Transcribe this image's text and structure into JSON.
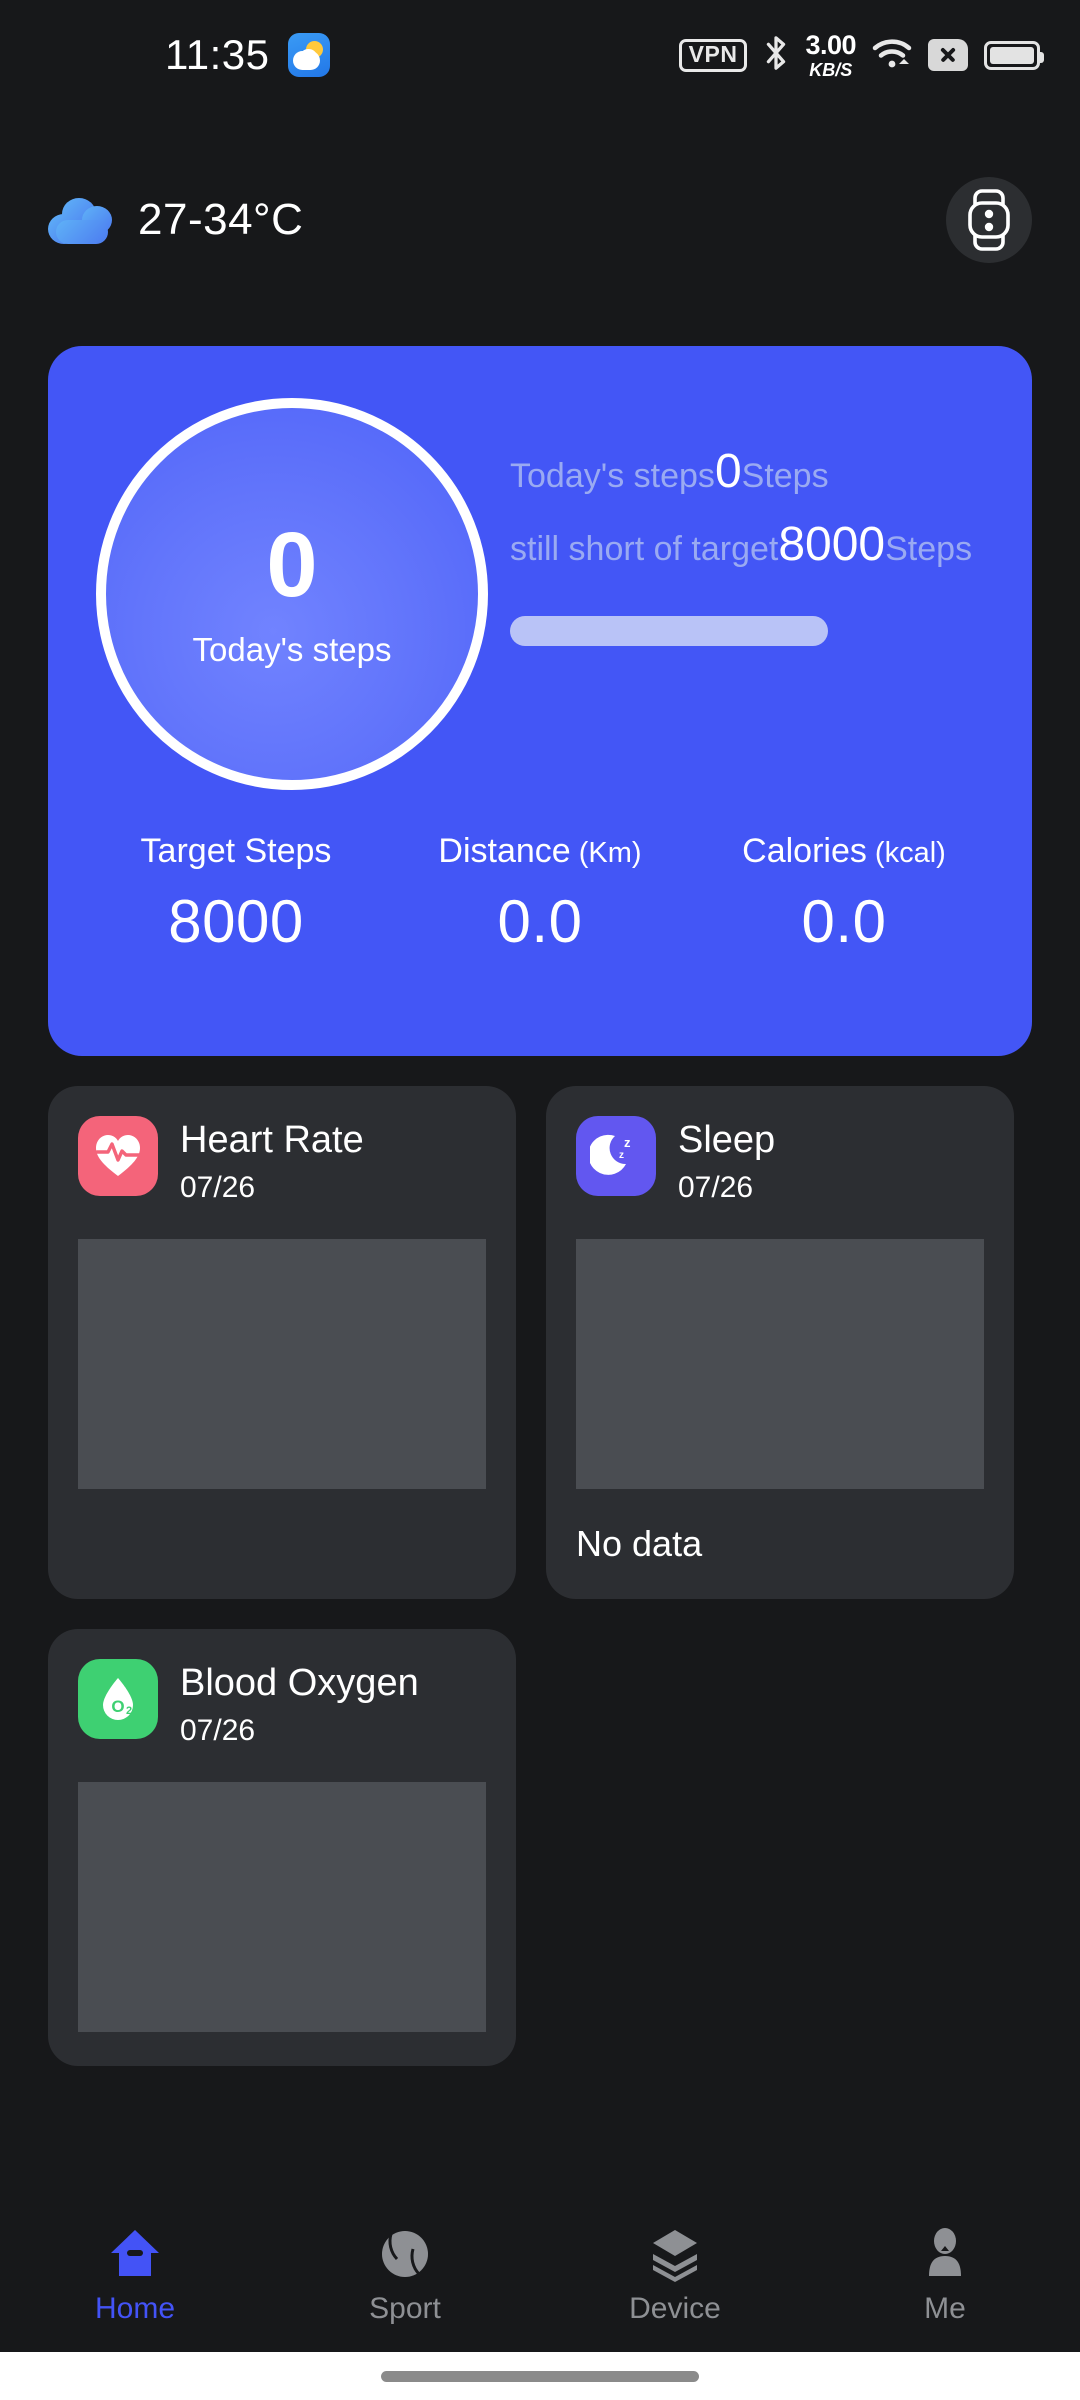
{
  "status_bar": {
    "time": "11:35",
    "weather_app_icon": "weather-app-icon",
    "vpn_label": "VPN",
    "bluetooth_icon": "bluetooth-icon",
    "network_speed_value": "3.00",
    "network_speed_unit": "KB/S",
    "wifi_icon": "wifi-icon",
    "sim_icon": "sim-no-signal-icon",
    "battery_icon": "battery-full-icon"
  },
  "header": {
    "weather_icon": "cloud-icon",
    "temperature": "27-34°C",
    "device_button_icon": "fitness-band-icon"
  },
  "steps_card": {
    "background_color": "#4356F6",
    "ring": {
      "value": "0",
      "label": "Today's steps"
    },
    "today_line": {
      "label": "Today's steps",
      "value": "0",
      "unit": "Steps"
    },
    "target_line": {
      "label": "still short of target",
      "value": "8000",
      "unit": "Steps"
    },
    "progress_percent": 0,
    "stats": [
      {
        "label": "Target Steps",
        "unit": "",
        "value": "8000"
      },
      {
        "label": "Distance",
        "unit": " (Km)",
        "value": "0.0"
      },
      {
        "label": "Calories",
        "unit": " (kcal)",
        "value": "0.0"
      }
    ]
  },
  "metric_cards": [
    {
      "title": "Heart Rate",
      "date": "07/26",
      "icon": "heart-pulse-icon",
      "icon_color": "#F4647A",
      "no_data_label": ""
    },
    {
      "title": "Sleep",
      "date": "07/26",
      "icon": "moon-sleep-icon",
      "icon_color": "#6257F0",
      "no_data_label": "No data"
    },
    {
      "title": "Blood Oxygen",
      "date": "07/26",
      "icon": "blood-oxygen-droplet-icon",
      "icon_color": "#3ED072",
      "no_data_label": ""
    }
  ],
  "bottom_nav": {
    "active_color": "#4353F6",
    "inactive_color": "#8E9094",
    "items": [
      {
        "label": "Home",
        "icon": "home-icon",
        "active": true
      },
      {
        "label": "Sport",
        "icon": "ball-icon",
        "active": false
      },
      {
        "label": "Device",
        "icon": "layers-icon",
        "active": false
      },
      {
        "label": "Me",
        "icon": "person-icon",
        "active": false
      }
    ]
  }
}
